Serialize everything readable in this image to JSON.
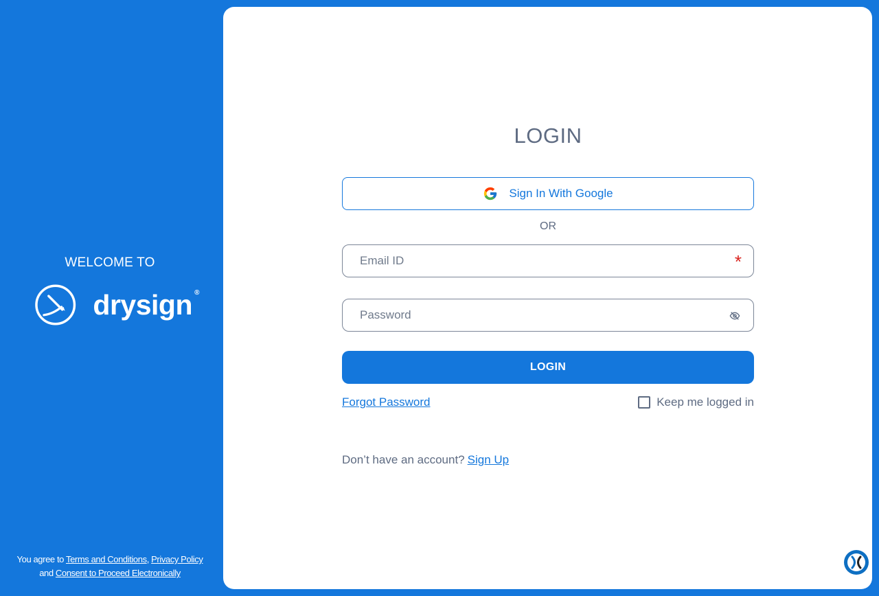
{
  "left": {
    "welcome": "WELCOME TO",
    "brand_name": "drysign",
    "brand_reg": "®",
    "legal": {
      "prefix": "You agree to",
      "terms": "Terms and Conditions",
      "comma": ",",
      "privacy": "Privacy Policy",
      "and": "and",
      "consent": "Consent to Proceed Electronically"
    }
  },
  "login": {
    "title": "LOGIN",
    "google_button": "Sign In With Google",
    "or": "OR",
    "email_placeholder": "Email ID",
    "required_marker": "*",
    "password_placeholder": "Password",
    "submit": "LOGIN",
    "forgot": "Forgot Password",
    "keep_logged_in": "Keep me logged in",
    "no_account": "Don’t have an account?",
    "signup": "Sign Up"
  },
  "colors": {
    "brand_blue": "#1477dc",
    "text_gray": "#5e6b82",
    "required_red": "#d9231e"
  },
  "icons": {
    "google": "google-icon",
    "eye_off": "eye-off-icon",
    "brand_mark": "drysign-logo-icon",
    "chat": "chat-widget-icon"
  }
}
